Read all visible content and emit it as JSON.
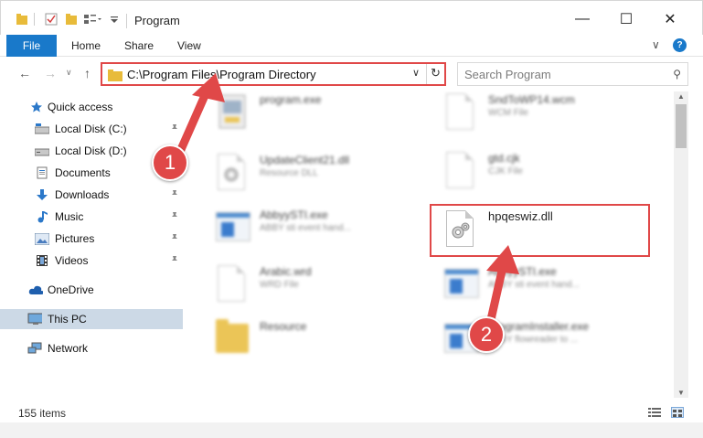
{
  "window": {
    "title": "Program",
    "minimize_glyph": "—",
    "maximize_glyph": "☐",
    "close_glyph": "✕"
  },
  "ribbon": {
    "tabs": [
      "File",
      "Home",
      "Share",
      "View"
    ],
    "expand_glyph": "∨",
    "help_glyph": "?"
  },
  "navigation": {
    "back_glyph": "←",
    "forward_glyph": "→",
    "recent_glyph": "∨",
    "up_glyph": "↑",
    "address": "C:\\Program Files\\Program Directory",
    "address_dropdown_glyph": "∨",
    "refresh_glyph": "↻",
    "search_placeholder": "Search Program",
    "search_glyph": "⚲"
  },
  "sidebar": {
    "items": [
      {
        "label": "Quick access",
        "icon": "star-icon",
        "pinned": false
      },
      {
        "label": "Local Disk (C:)",
        "icon": "drive-icon",
        "pinned": true
      },
      {
        "label": "Local Disk (D:)",
        "icon": "drive-icon",
        "pinned": false
      },
      {
        "label": "Documents",
        "icon": "documents-icon",
        "pinned": true
      },
      {
        "label": "Downloads",
        "icon": "download-icon",
        "pinned": true
      },
      {
        "label": "Music",
        "icon": "music-icon",
        "pinned": true
      },
      {
        "label": "Pictures",
        "icon": "pictures-icon",
        "pinned": true
      },
      {
        "label": "Videos",
        "icon": "videos-icon",
        "pinned": true
      },
      {
        "label": "OneDrive",
        "icon": "cloud-icon",
        "pinned": false
      },
      {
        "label": "This PC",
        "icon": "computer-icon",
        "pinned": false,
        "selected": true
      },
      {
        "label": "Network",
        "icon": "network-icon",
        "pinned": false
      }
    ],
    "pin_glyph": "📌"
  },
  "files": {
    "left": [
      {
        "name": "program.exe",
        "type": "",
        "kind": "installer"
      },
      {
        "name": "UpdateClient21.dll",
        "type": "Resource DLL",
        "kind": "dll"
      },
      {
        "name": "AbbyySTI.exe",
        "type": "ABBY sti event hand...",
        "kind": "exe"
      },
      {
        "name": "Arabic.wrd",
        "type": "WRD File",
        "kind": "doc"
      },
      {
        "name": "Resource",
        "type": "",
        "kind": "folder"
      }
    ],
    "right": [
      {
        "name": "SndToWP14.wcm",
        "type": "WCM File",
        "kind": "doc"
      },
      {
        "name": "gtd.cjk",
        "type": "CJK File",
        "kind": "doc"
      },
      {
        "name": "hpqeswiz.dll",
        "type": "",
        "kind": "dll"
      },
      {
        "name": "AbbyySTI.exe",
        "type": "ABBY sti event hand...",
        "kind": "exe"
      },
      {
        "name": "ProgramInstaller.exe",
        "type": "ABBY flowreader to ...",
        "kind": "exe"
      }
    ]
  },
  "status": {
    "item_count": "155 items"
  },
  "annotations": {
    "step1": "1",
    "step2": "2",
    "color": "#e04848"
  }
}
